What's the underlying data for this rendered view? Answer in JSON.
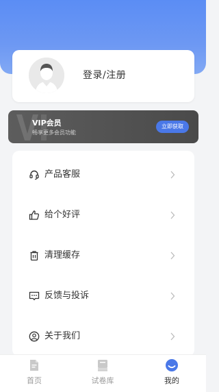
{
  "profile": {
    "login_label": "登录/注册"
  },
  "vip": {
    "title": "VIP会员",
    "subtitle": "畅享更多会员功能",
    "button_label": "立即获取"
  },
  "menu": {
    "items": [
      {
        "label": "产品客服",
        "icon": "headset-icon"
      },
      {
        "label": "给个好评",
        "icon": "thumbs-up-icon"
      },
      {
        "label": "清理缓存",
        "icon": "trash-icon"
      },
      {
        "label": "反馈与投诉",
        "icon": "feedback-icon"
      },
      {
        "label": "关于我们",
        "icon": "user-circle-icon"
      }
    ]
  },
  "tabbar": {
    "tabs": [
      {
        "label": "首页",
        "icon": "document-icon",
        "active": false
      },
      {
        "label": "试卷库",
        "icon": "books-icon",
        "active": false
      },
      {
        "label": "我的",
        "icon": "profile-icon",
        "active": true
      }
    ]
  },
  "colors": {
    "header_blue": "#5b8df4",
    "vip_button_blue": "#4a78e8",
    "vip_card_gray": "#4a4a4a",
    "active_tab_blue": "#4a78e8"
  }
}
